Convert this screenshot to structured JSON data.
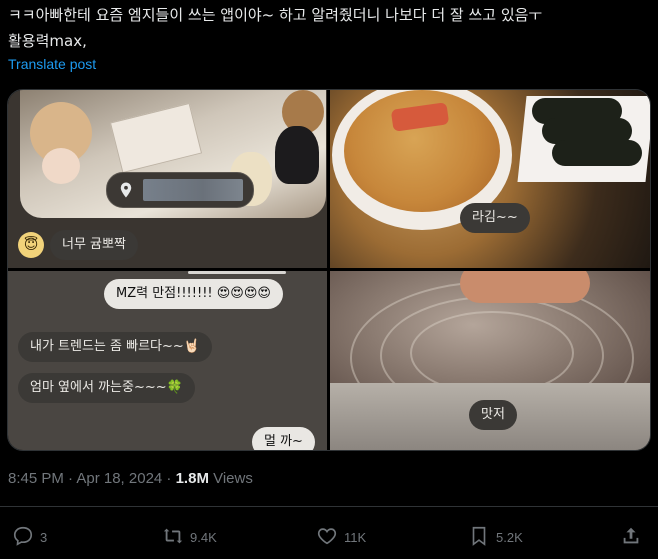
{
  "tweet": {
    "text": "ㅋㅋ아빠한테 요즘 엠지들이 쓰는 앱이야~ 하고 알려줬더니 나보다 더 잘 쓰고 있음ㅜ\n활용력max,",
    "translate_label": "Translate post"
  },
  "media": {
    "cell1": {
      "bubble": "너무 귬뽀짝"
    },
    "cell2": {
      "bubble": "라김~~"
    },
    "cell3": {
      "bubble1": "MZ력 만점!!!!!!! 😍😍😍😍",
      "bubble2": "내가 트렌드는 좀 빠르다~~🤘🏻",
      "bubble3": "엄마 옆에서 까는중~~~🍀",
      "bubble4": "멀 까~"
    },
    "cell4": {
      "bubble": "맛저"
    }
  },
  "meta": {
    "time": "8:45 PM · Apr 18, 2024 · ",
    "views_count": "1.8M",
    "views_label": " Views"
  },
  "actions": {
    "replies": "3",
    "reposts": "9.4K",
    "likes": "11K",
    "bookmarks": "5.2K"
  },
  "icons": {
    "reply": "reply-icon",
    "repost": "repost-icon",
    "like": "heart-icon",
    "bookmark": "bookmark-icon",
    "share": "share-icon",
    "location": "location-pin-icon"
  },
  "colors": {
    "background": "#000000",
    "text": "#e7e9ea",
    "muted": "#71767b",
    "link": "#1d9bf0",
    "border": "#2f3336"
  }
}
